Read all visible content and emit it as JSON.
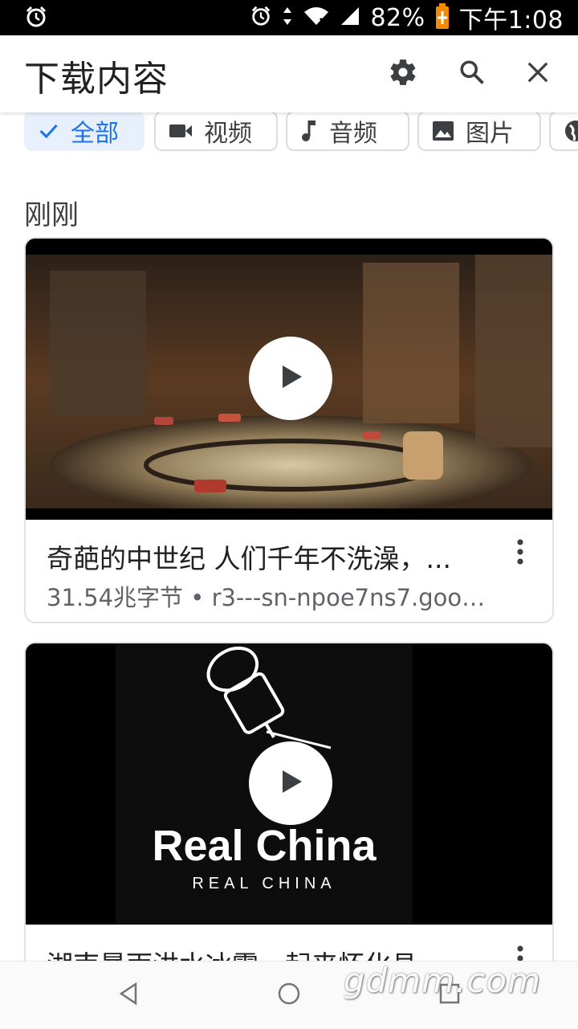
{
  "status_bar": {
    "battery": "82%",
    "time": "下午1:08"
  },
  "app_bar": {
    "title": "下载内容",
    "icons": [
      "gear-icon",
      "search-icon",
      "close-icon"
    ]
  },
  "chips": [
    {
      "label": "全部",
      "icon": "check-icon",
      "selected": true
    },
    {
      "label": "视频",
      "icon": "video-icon",
      "selected": false
    },
    {
      "label": "音频",
      "icon": "music-note-icon",
      "selected": false
    },
    {
      "label": "图片",
      "icon": "image-icon",
      "selected": false
    }
  ],
  "section": {
    "label": "刚刚"
  },
  "items": [
    {
      "title": "奇葩的中世纪 人们千年不洗澡，...",
      "subtitle": "31.54兆字节 • r3---sn-npoe7ns7.goog..."
    },
    {
      "title": "湖南暴雨洪水冰雹一起来怀化县",
      "thumb_text": "Real China",
      "thumb_subtext": "REAL CHINA"
    }
  ],
  "watermark": "gdmm.com",
  "colors": {
    "accent": "#1a73e8",
    "chip_selected_bg": "#e8f0fe"
  }
}
